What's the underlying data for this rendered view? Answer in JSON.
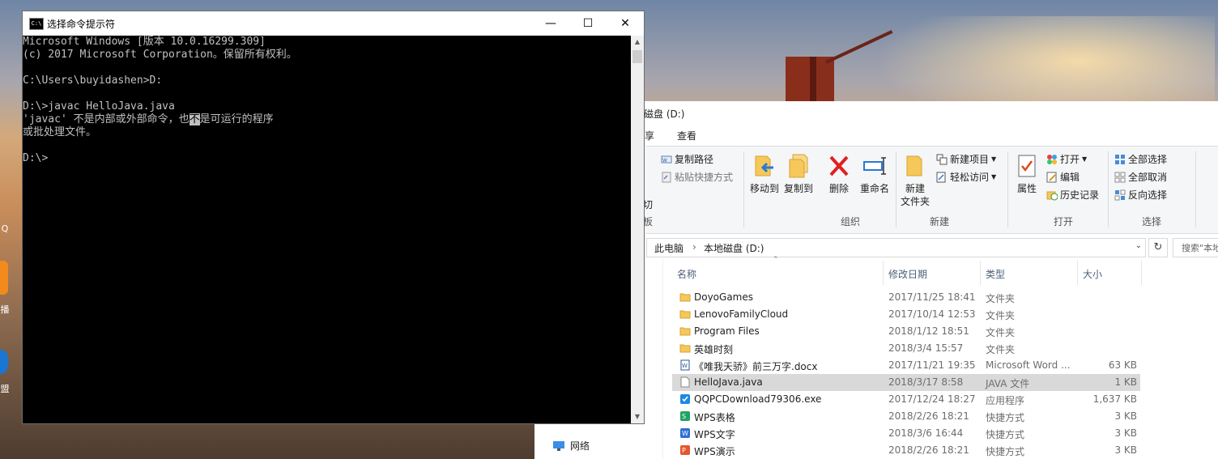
{
  "desktop": {
    "icon_labels": [
      "Q",
      "播",
      "盟"
    ]
  },
  "cmd": {
    "title": "选择命令提示符",
    "icon_text": "C:\\",
    "controls": {
      "minimize": "—",
      "maximize": "☐",
      "close": "✕"
    },
    "lines": [
      "Microsoft Windows [版本 10.0.16299.309]",
      "(c) 2017 Microsoft Corporation。保留所有权利。",
      "",
      "C:\\Users\\buyidashen>D:",
      "",
      "D:\\>javac HelloJava.java",
      "",
      "或批处理文件。",
      "",
      "D:\\>"
    ],
    "error_before": "'javac' 不是内部或外部命令，也",
    "error_selected": "不",
    "error_after": "是可运行的程序"
  },
  "explorer": {
    "title": "磁盘 (D:)",
    "tabs": {
      "share": "享",
      "view": "查看"
    },
    "ribbon": {
      "copy_path": "复制路径",
      "paste_shortcut": "粘贴快捷方式",
      "cut": "切",
      "clipboard_group": "板",
      "move_to": "移动到",
      "copy_to": "复制到",
      "delete": "删除",
      "rename": "重命名",
      "organize_group": "组织",
      "new_folder_line1": "新建",
      "new_folder_line2": "文件夹",
      "new_item": "新建项目",
      "easy_access": "轻松访问",
      "new_group": "新建",
      "properties": "属性",
      "open": "打开",
      "edit": "编辑",
      "history": "历史记录",
      "open_group": "打开",
      "select_all": "全部选择",
      "select_none": "全部取消",
      "invert_selection": "反向选择",
      "select_group": "选择"
    },
    "address": {
      "root": "此电脑",
      "sep": "›",
      "current": "本地磁盘 (D:)"
    },
    "search_placeholder": "搜索\"本地磁盘 (D:)\"",
    "nav": {
      "network": "网络"
    },
    "columns": {
      "name": "名称",
      "date": "修改日期",
      "type": "类型",
      "size": "大小"
    },
    "files": [
      {
        "name": "DoyoGames",
        "date": "2017/11/25 18:41",
        "type": "文件夹",
        "size": "",
        "icon": "folder-icon"
      },
      {
        "name": "LenovoFamilyCloud",
        "date": "2017/10/14 12:53",
        "type": "文件夹",
        "size": "",
        "icon": "folder-icon"
      },
      {
        "name": "Program Files",
        "date": "2018/1/12 18:51",
        "type": "文件夹",
        "size": "",
        "icon": "folder-icon"
      },
      {
        "name": "英雄时刻",
        "date": "2018/3/4 15:57",
        "type": "文件夹",
        "size": "",
        "icon": "folder-icon"
      },
      {
        "name": "《唯我天骄》前三万字.docx",
        "date": "2017/11/21 19:35",
        "type": "Microsoft Word ...",
        "size": "63 KB",
        "icon": "word-document-icon"
      },
      {
        "name": "HelloJava.java",
        "date": "2018/3/17 8:58",
        "type": "JAVA 文件",
        "size": "1 KB",
        "icon": "file-icon"
      },
      {
        "name": "QQPCDownload79306.exe",
        "date": "2017/12/24 18:27",
        "type": "应用程序",
        "size": "1,637 KB",
        "icon": "exe-icon"
      },
      {
        "name": "WPS表格",
        "date": "2018/2/26 18:21",
        "type": "快捷方式",
        "size": "3 KB",
        "icon": "wps-sheets-icon"
      },
      {
        "name": "WPS文字",
        "date": "2018/3/6 16:44",
        "type": "快捷方式",
        "size": "3 KB",
        "icon": "wps-writer-icon"
      },
      {
        "name": "WPS演示",
        "date": "2018/2/26 18:21",
        "type": "快捷方式",
        "size": "3 KB",
        "icon": "wps-presentation-icon"
      }
    ]
  }
}
